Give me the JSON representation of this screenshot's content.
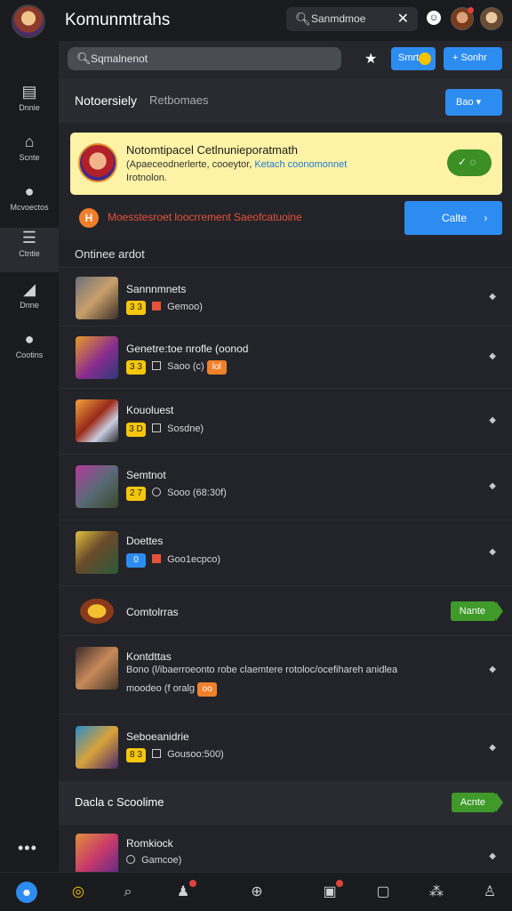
{
  "topbar": {
    "title": "Komunmtrahs",
    "search_value": "Sanmdmoe",
    "icons": [
      "app-avatar",
      "search-icon",
      "clear-icon",
      "chat-icon",
      "user-avatar",
      "profile-avatar"
    ]
  },
  "sidebar": {
    "items": [
      {
        "label": "Dnnie",
        "icon": "grid-icon"
      },
      {
        "label": "Scnte",
        "icon": "home-icon"
      },
      {
        "label": "Mcvoectos",
        "icon": "chat-bubble-icon"
      },
      {
        "label": "Ctntie",
        "icon": "list-icon"
      },
      {
        "label": "Dnne",
        "icon": "tag-icon"
      },
      {
        "label": "Cootins",
        "icon": "person-icon"
      }
    ],
    "more_label": "•••"
  },
  "toolbar": {
    "search_value": "Sqmalnenot",
    "start_label": "Smrt",
    "sonhr_label": "+ Sonhr"
  },
  "section": {
    "title": "Notoersiely",
    "subtitle": "Retbomaes",
    "button_label": "Bao ▾"
  },
  "notice": {
    "heading": "Notomtipacel Cetlnunieporatmath",
    "body_prefix": "(Apaeceodnerlerte, cooeytor,",
    "body_link": "Ketach coonomonnet",
    "body_line2": "Irotnolon."
  },
  "alert": {
    "text": "Moesstesroet loocrrement Saeofcatuoine",
    "cta_label": "Calte"
  },
  "list": {
    "title": "Ontinee ardot",
    "rows": [
      {
        "name": "Sannnmnets",
        "tag": "3 3",
        "meta": "Gemoo)",
        "tag2": ""
      },
      {
        "name": "Genetre:toe nrofle (oonod",
        "tag": "3 3",
        "meta": "Saoo (c)",
        "tag2": "lol"
      },
      {
        "name": "Kouoluest",
        "tag": "3 D",
        "meta": "Sosdne)",
        "tag2": ""
      },
      {
        "name": "Semtnot",
        "tag": "2 7",
        "meta": "Sooo (68:30f)",
        "tag2": ""
      },
      {
        "name": "Doettes",
        "tag": "0",
        "meta": "Goo1ecpco)",
        "tag2": ""
      },
      {
        "name": "Comtolrras",
        "tag": "",
        "meta": "",
        "tag2": "",
        "pill": "Nante"
      },
      {
        "name": "Kontdttas",
        "tag": "",
        "meta": "Bono (l/ibaerroeonto robe claemtere rotoloc/ocefihareh anidlea",
        "meta2": "moodeo (f oralg",
        "tag2": "oo"
      },
      {
        "name": "Seboeanidrie",
        "tag": "8 3",
        "meta": "Gousoo:500)",
        "tag2": ""
      }
    ]
  },
  "list2": {
    "title": "Dacla c Scoolime",
    "pill": "Acnte",
    "rows": [
      {
        "name": "Romkiock",
        "meta": "Gamcoe)"
      }
    ]
  },
  "bottombar": {
    "icons": [
      "home-active-icon",
      "target-icon",
      "search-icon",
      "people-icon",
      "bag-icon",
      "gift-icon",
      "image-icon",
      "group-icon",
      "profile-icon"
    ]
  },
  "colors": {
    "accent": "#2d8cf0",
    "notice_bg": "#fdf2a5",
    "alert_text": "#e5523a",
    "success": "#3f9a2a",
    "background": "#1c1d21"
  }
}
